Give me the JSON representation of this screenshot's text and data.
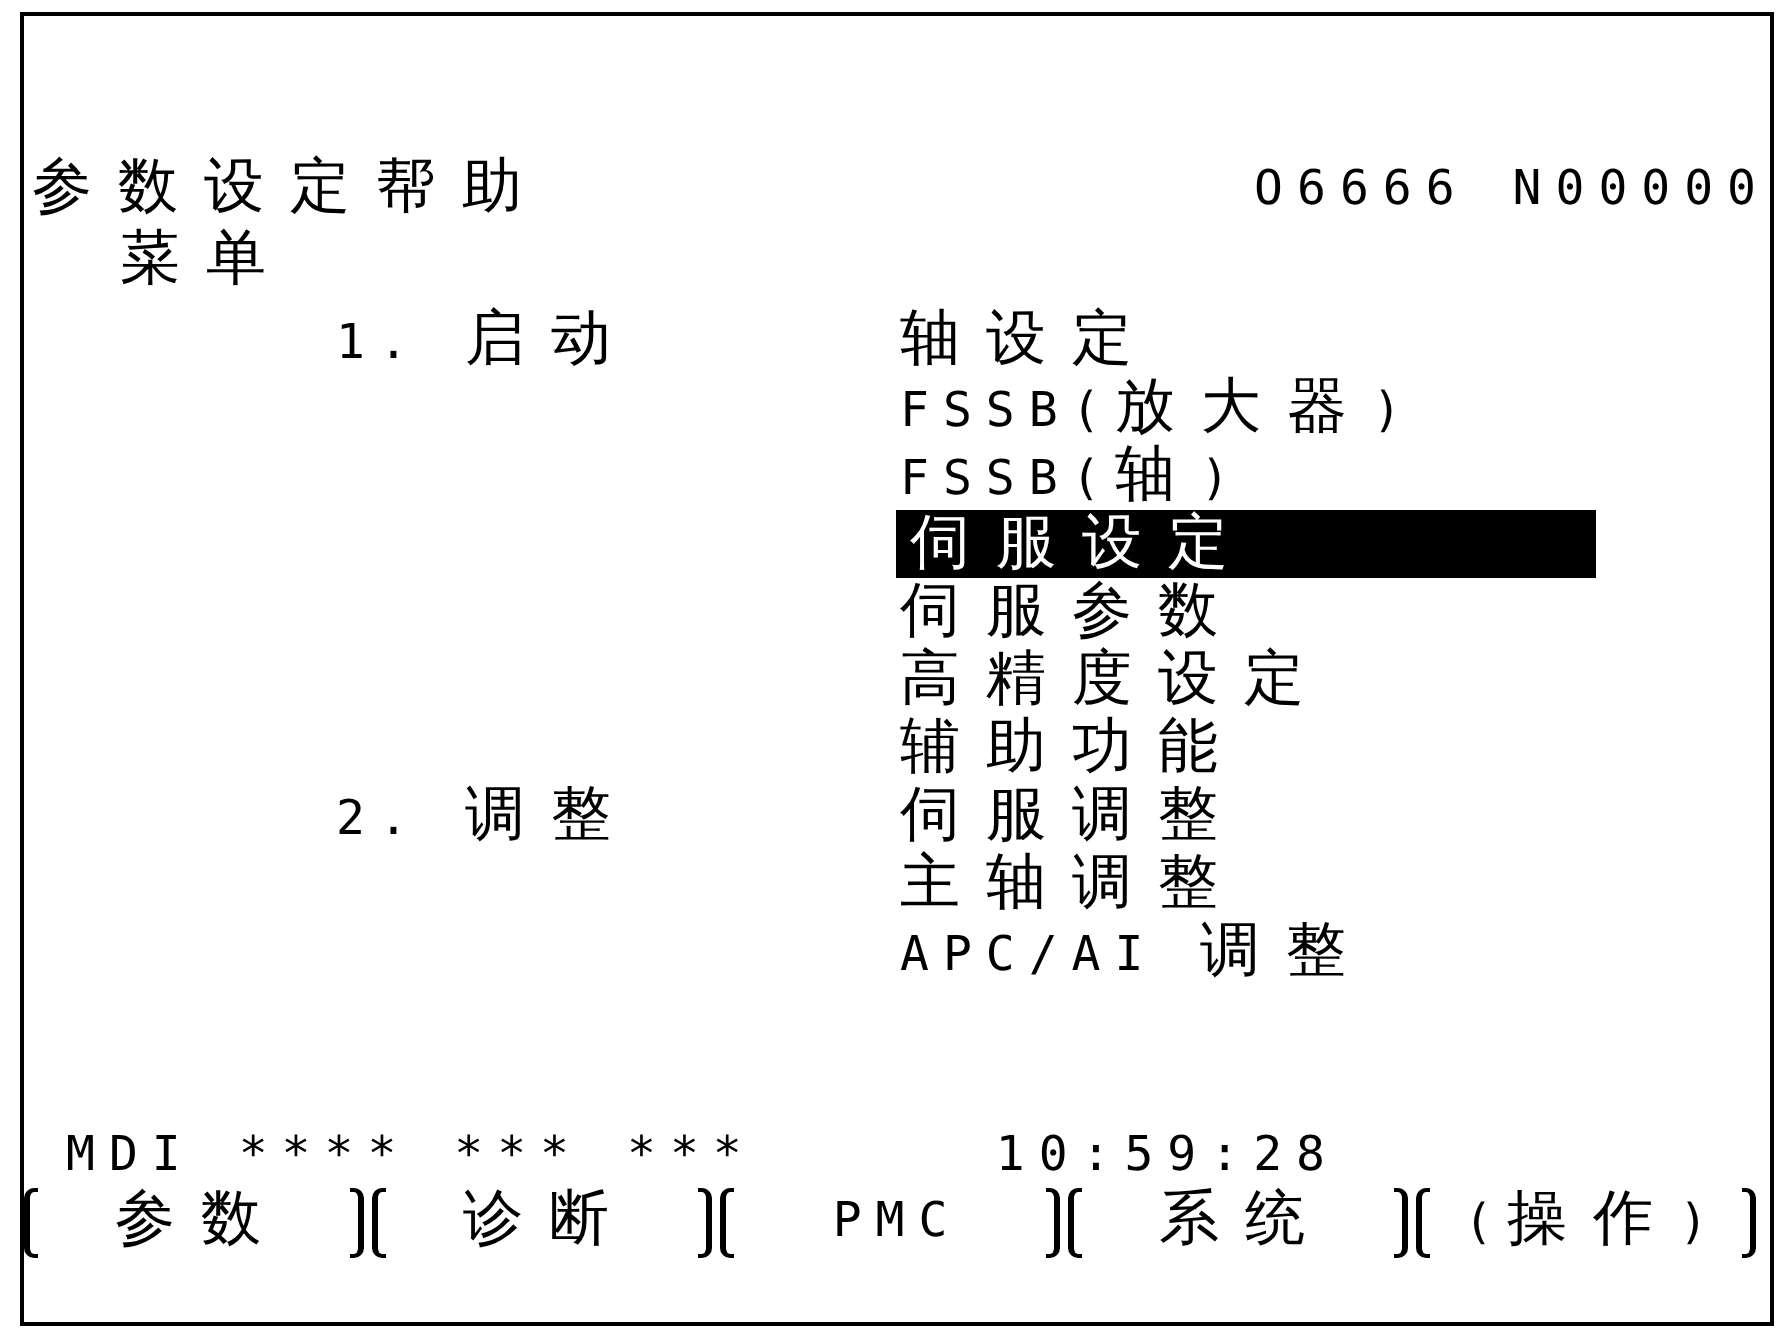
{
  "screen": {
    "title_lines": [
      "参数设定帮助",
      "菜单"
    ],
    "program_number": "O6666",
    "sequence_number": "N00000"
  },
  "menu": [
    {
      "label": "1. 启动",
      "items": [
        {
          "label": "轴设定",
          "selected": false
        },
        {
          "label": "FSSB(放大器)",
          "selected": false
        },
        {
          "label": "FSSB(轴)",
          "selected": false
        },
        {
          "label": "伺服设定",
          "selected": true
        },
        {
          "label": "伺服参数",
          "selected": false
        },
        {
          "label": "高精度设定",
          "selected": false
        },
        {
          "label": "辅助功能",
          "selected": false
        }
      ]
    },
    {
      "label": "2. 调整",
      "items": [
        {
          "label": "伺服调整",
          "selected": false
        },
        {
          "label": "主轴调整",
          "selected": false
        },
        {
          "label": "APC/AI 调整",
          "selected": false
        }
      ]
    }
  ],
  "status_bar": {
    "mode": "MDI",
    "fields": [
      "****",
      "***",
      "***"
    ],
    "time": "10:59:28"
  },
  "softkeys": [
    "参数",
    "诊断",
    "PMC",
    "系统",
    "(操作)"
  ]
}
